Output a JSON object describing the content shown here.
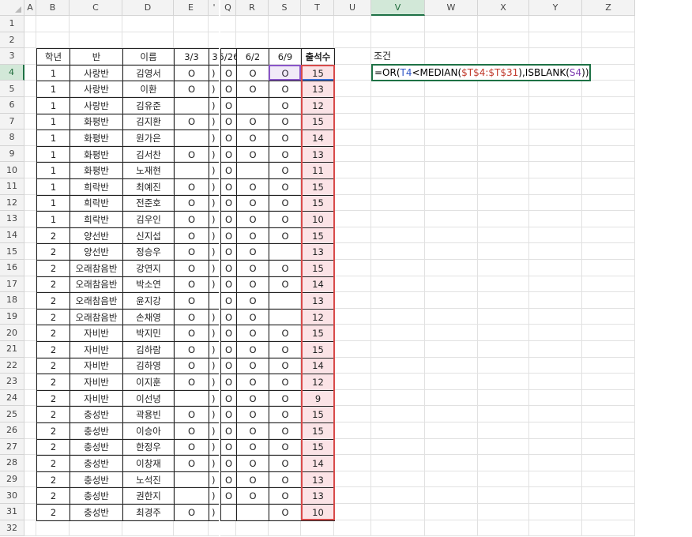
{
  "columns": [
    "A",
    "B",
    "C",
    "D",
    "E",
    "'",
    "Q",
    "R",
    "S",
    "T",
    "U",
    "V",
    "W",
    "X",
    "Y",
    "Z"
  ],
  "rows": [
    "1",
    "2",
    "3",
    "4",
    "5",
    "6",
    "7",
    "8",
    "9",
    "10",
    "11",
    "12",
    "13",
    "14",
    "15",
    "16",
    "17",
    "18",
    "19",
    "20",
    "21",
    "22",
    "23",
    "24",
    "25",
    "26",
    "27",
    "28",
    "29",
    "30",
    "31",
    "32"
  ],
  "table": {
    "headers": [
      "학년",
      "반",
      "이름",
      "3/3",
      "3",
      "5/26",
      "6/2",
      "6/9",
      "출석수"
    ],
    "rows": [
      [
        "1",
        "사랑반",
        "김영서",
        "O",
        ")",
        "O",
        "O",
        "O",
        "15"
      ],
      [
        "1",
        "사랑반",
        "이환",
        "O",
        ")",
        "O",
        "O",
        "O",
        "13"
      ],
      [
        "1",
        "사랑반",
        "김유준",
        "",
        ")",
        "O",
        "",
        "O",
        "12"
      ],
      [
        "1",
        "화평반",
        "김지환",
        "O",
        ")",
        "O",
        "O",
        "O",
        "15"
      ],
      [
        "1",
        "화평반",
        "원가은",
        "",
        ")",
        "O",
        "O",
        "O",
        "14"
      ],
      [
        "1",
        "화평반",
        "김서찬",
        "O",
        ")",
        "O",
        "O",
        "O",
        "13"
      ],
      [
        "1",
        "화평반",
        "노재현",
        "",
        ")",
        "O",
        "",
        "O",
        "11"
      ],
      [
        "1",
        "희락반",
        "최예진",
        "O",
        ")",
        "O",
        "O",
        "O",
        "15"
      ],
      [
        "1",
        "희락반",
        "전준호",
        "O",
        ")",
        "O",
        "O",
        "O",
        "15"
      ],
      [
        "1",
        "희락반",
        "김우인",
        "O",
        ")",
        "O",
        "O",
        "O",
        "10"
      ],
      [
        "2",
        "양선반",
        "신지섭",
        "O",
        ")",
        "O",
        "O",
        "O",
        "15"
      ],
      [
        "2",
        "양선반",
        "정승우",
        "O",
        ")",
        "O",
        "O",
        "",
        "13"
      ],
      [
        "2",
        "오래참음반",
        "강연지",
        "O",
        ")",
        "O",
        "O",
        "O",
        "15"
      ],
      [
        "2",
        "오래참음반",
        "박소연",
        "O",
        ")",
        "O",
        "O",
        "O",
        "14"
      ],
      [
        "2",
        "오래참음반",
        "윤지강",
        "O",
        "",
        "O",
        "O",
        "",
        "13"
      ],
      [
        "2",
        "오래참음반",
        "손채영",
        "O",
        ")",
        "O",
        "O",
        "",
        "12"
      ],
      [
        "2",
        "자비반",
        "박지민",
        "O",
        ")",
        "O",
        "O",
        "O",
        "15"
      ],
      [
        "2",
        "자비반",
        "김하람",
        "O",
        ")",
        "O",
        "O",
        "O",
        "15"
      ],
      [
        "2",
        "자비반",
        "김하영",
        "O",
        ")",
        "O",
        "O",
        "O",
        "14"
      ],
      [
        "2",
        "자비반",
        "이지훈",
        "O",
        ")",
        "O",
        "O",
        "O",
        "12"
      ],
      [
        "2",
        "자비반",
        "이선녕",
        "",
        ")",
        "O",
        "O",
        "O",
        "9"
      ],
      [
        "2",
        "충성반",
        "곽용빈",
        "O",
        ")",
        "O",
        "O",
        "O",
        "15"
      ],
      [
        "2",
        "충성반",
        "이승아",
        "O",
        ")",
        "O",
        "O",
        "O",
        "15"
      ],
      [
        "2",
        "충성반",
        "한정우",
        "O",
        ")",
        "O",
        "O",
        "O",
        "15"
      ],
      [
        "2",
        "충성반",
        "이창재",
        "O",
        ")",
        "O",
        "O",
        "O",
        "14"
      ],
      [
        "2",
        "충성반",
        "노석진",
        "",
        ")",
        "O",
        "O",
        "O",
        "13"
      ],
      [
        "2",
        "충성반",
        "권한지",
        "",
        ")",
        "O",
        "O",
        "O",
        "13"
      ],
      [
        "2",
        "충성반",
        "최경주",
        "O",
        ")",
        "",
        "",
        "O",
        "10"
      ]
    ]
  },
  "condition": {
    "label": "조건",
    "formula_parts": [
      "=OR(",
      "T4",
      "<MEDIAN(",
      "$T$4:$T$31",
      ")",
      ",ISBLANK(",
      "S4",
      "))"
    ]
  },
  "colors": {
    "accent": "#1e7145",
    "pink": "#fbe3e6",
    "ref_blue": "#2e55c5",
    "ref_red": "#c0392b",
    "ref_purple": "#7e3fb0"
  }
}
